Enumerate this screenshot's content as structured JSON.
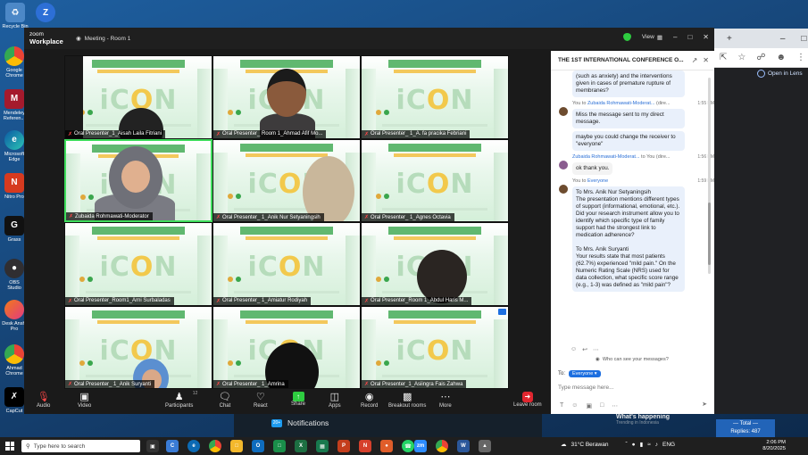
{
  "desktop": {
    "icons": [
      {
        "label": "Recycle Bin",
        "icon": "recycle-icon"
      },
      {
        "label": "Google Chrome",
        "icon": "chrome-icon"
      },
      {
        "label": "Mendeley Referen...",
        "icon": "mendeley-icon"
      },
      {
        "label": "Microsoft Edge",
        "icon": "edge-icon"
      },
      {
        "label": "Nitro Pro",
        "icon": "nitro-icon"
      },
      {
        "label": "Grass",
        "icon": "grass-icon"
      },
      {
        "label": "OBS Studio",
        "icon": "obs-icon"
      },
      {
        "label": "Desk Anshi Pro",
        "icon": "app-icon"
      },
      {
        "label": "Ahmad Chrome",
        "icon": "chrome-icon"
      },
      {
        "label": "CapCut",
        "icon": "capcut-icon"
      }
    ],
    "top_icon_label": "Shortcut",
    "colors": {
      "chrome_red": "#ea4335",
      "chrome_yellow": "#fbbc05",
      "chrome_green": "#34a853"
    }
  },
  "browser": {
    "open_in_lens": "Open in Lens",
    "tab_plus": "+",
    "tab_minimize": "–",
    "tab_restore": "□"
  },
  "zoom": {
    "brand_line1": "zoom",
    "brand_line2": "Workplace",
    "meeting_title": "Meeting - Room 1",
    "view_label": "View",
    "win_minimize": "–",
    "win_maximize": "□",
    "win_close": "✕",
    "accent_green": "#2ecc40",
    "slide_logo": "iC",
    "slide_logo_o": "O",
    "slide_logo_n": "N",
    "tiles": [
      {
        "name": "Oral Presenter_1_Aisah Laila Fitriani",
        "active": false,
        "person": "hijab-dark",
        "half_black": true
      },
      {
        "name": "Oral Presenter_ Room 1_Ahmad Afif Mo...",
        "active": false,
        "person": "man",
        "half_black": false
      },
      {
        "name": "Oral Presenter_ 1_A. fa pracika Febriani",
        "active": false,
        "person": "none",
        "half_black": false
      },
      {
        "name": "Zubaida Rohmawati-Moderator",
        "active": true,
        "person": "hijab-speaker",
        "half_black": false
      },
      {
        "name": "Oral Presenter_ 1_Anik Nur Setyaningsih",
        "active": false,
        "person": "hijab-side",
        "half_black": false
      },
      {
        "name": "Oral Presenter_ 1_Agnes Octavia",
        "active": false,
        "person": "none",
        "half_black": false
      },
      {
        "name": "Oral Presenter_Room1_Arni Surbaladas",
        "active": false,
        "person": "none",
        "half_black": false
      },
      {
        "name": "Oral Presenter_ 1_Amiatur Rodiyah",
        "active": false,
        "person": "none",
        "half_black": false
      },
      {
        "name": "Oral Presenter_Room 1_Abdul Haris M...",
        "active": false,
        "person": "head-back",
        "half_black": false
      },
      {
        "name": "Oral Presenter_ 1_Anik Suryanti",
        "active": false,
        "person": "hijab-blue",
        "half_black": false
      },
      {
        "name": "Oral Presenter_ 1_Amrina",
        "active": false,
        "person": "hijab-black",
        "half_black": false
      },
      {
        "name": "Oral Presenter_1_Asiingra Fais Zahwa",
        "active": false,
        "person": "none",
        "half_black": false
      }
    ],
    "toolbar": {
      "audio": "Audio",
      "video": "Video",
      "participants": "Participants",
      "participants_count": "12",
      "chat": "Chat",
      "react": "React",
      "share": "Share",
      "apps": "Apps",
      "record": "Record",
      "breakout": "Breakout rooms",
      "more": "More",
      "leave": "Leave room"
    }
  },
  "chat": {
    "title": "THE 1ST INTERNATIONAL CONFERENCE O...",
    "messages": [
      {
        "kind": "cont",
        "text": "(such as anxiety) and the interventions given in cases of premature rupture of membranes?"
      },
      {
        "kind": "head",
        "prefix": "You to",
        "who": "Zubaida Rohmawati-Moderat...",
        "tag": "(dire...",
        "time": "1:55 PM",
        "avatar": "brown"
      },
      {
        "kind": "bubble",
        "text": "Miss the message sent to my direct message."
      },
      {
        "kind": "bubble",
        "text": "maybe you could change the receiver to \"everyone\""
      },
      {
        "kind": "head",
        "prefix": "",
        "who": "Zubaida Rohmawati-Moderat...",
        "tag": "to You (dire...",
        "time": "1:56 PM",
        "avatar": "purple"
      },
      {
        "kind": "plain",
        "text": "ok thank you."
      },
      {
        "kind": "head",
        "prefix": "You to",
        "who": "Everyone",
        "tag": "",
        "time": "1:59 PM",
        "avatar": "brown"
      },
      {
        "kind": "bubble",
        "text": "To Mrs. Anik Nur Setyaningsih\nThe presentation mentions different types of support (informational, emotional, etc.). Did your research instrument allow you to identify which specific type of family support had the strongest link to medication adherence?\n\nTo Mrs. Anik Suryanti\nYour results state that most patients (62.7%) experienced \"mild pain.\" On the Numeric Rating Scale (NRS) used for data collection, what specific score range (e.g., 1-3) was defined as \"mild pain\"?"
      }
    ],
    "who_can_see": "Who can see your messages?",
    "to_label": "To:",
    "to_value": "Everyone",
    "compose_placeholder": "Type message here..."
  },
  "background": {
    "notifications": "Notifications",
    "notif_badge": "20+",
    "whats_happening": "What's happening",
    "trending": "Trending in Indonesia",
    "total_label": "— Total —",
    "replies": "Replies: 487"
  },
  "taskbar": {
    "search_placeholder": "Type here to search",
    "weather": "31°C  Berawan",
    "lang": "ENG",
    "time": "2:06 PM",
    "date": "8/20/2025"
  }
}
